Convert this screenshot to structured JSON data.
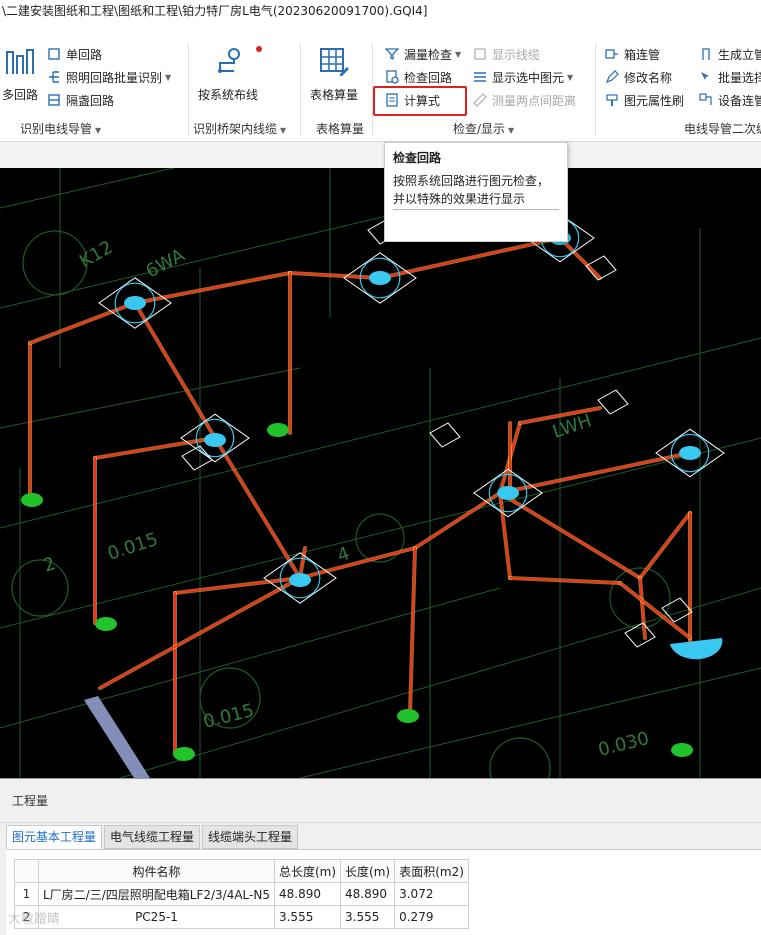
{
  "window": {
    "title": "\\二建安装图纸和工程\\图纸和工程\\铂力特厂房L电气(20230620091700).GQI4]"
  },
  "ribbon": {
    "groups": [
      {
        "label": "识别电线导管",
        "big_button": "多回路",
        "small_buttons": [
          "单回路",
          "照明回路批量识别",
          "隔盏回路"
        ]
      },
      {
        "label": "识别桥架内线缆",
        "big_button": "按系统布线"
      },
      {
        "label": "表格算量",
        "big_button": "表格算量"
      },
      {
        "label": "检查/显示",
        "small_buttons": [
          "漏量检查",
          "检查回路",
          "计算式",
          "显示线缆",
          "显示选中图元",
          "测量两点间距离"
        ]
      },
      {
        "label": "电线导管二次编",
        "small_buttons": [
          "箱连管",
          "修改名称",
          "图元属性刷",
          "生成立管",
          "批量选择",
          "设备连管"
        ]
      }
    ]
  },
  "tooltip": {
    "title": "检查回路",
    "description": "按照系统回路进行图元检查，并以特殊的效果进行显示"
  },
  "canvas": {
    "labels": [
      "K12",
      "6WA",
      "0.015",
      "0.015",
      "0.030",
      "2",
      "4",
      "LWH"
    ],
    "colors": {
      "background": "#000000",
      "path": "#ff2a1a",
      "path_glow": "#ffd24a",
      "fixture": "#38c8f0",
      "node": "#22c22a"
    }
  },
  "quantity_panel": {
    "title": "工程量",
    "tabs": [
      "图元基本工程量",
      "电气线缆工程量",
      "线缆端头工程量"
    ],
    "active_tab": "图元基本工程量",
    "columns": [
      "构件名称",
      "总长度(m)",
      "长度(m)",
      "表面积(m2)"
    ],
    "rows": [
      {
        "index": "1",
        "name": "L厂房二/三/四层照明配电箱LF2/3/4AL-N5",
        "total_length": "48.890",
        "length": "48.890",
        "area": "3.072"
      },
      {
        "index": "2",
        "name": "PC25-1",
        "total_length": "3.555",
        "length": "3.555",
        "area": "0.279"
      }
    ]
  },
  "watermark": "大敏蹭睛"
}
